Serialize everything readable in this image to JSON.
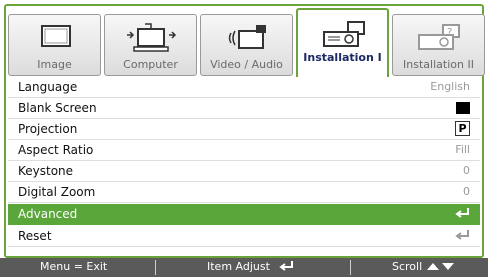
{
  "tabs": [
    {
      "label": "Image",
      "icon": "image-monitor-icon",
      "active": false
    },
    {
      "label": "Computer",
      "icon": "computer-icon",
      "active": false
    },
    {
      "label": "Video / Audio",
      "icon": "video-audio-icon",
      "active": false
    },
    {
      "label": "Installation I",
      "icon": "projector-icon",
      "active": true
    },
    {
      "label": "Installation II",
      "icon": "projector-settings-icon",
      "active": false
    }
  ],
  "menu": [
    {
      "label": "Language",
      "value": "English"
    },
    {
      "label": "Blank Screen",
      "value_icon": "black-square-icon"
    },
    {
      "label": "Projection",
      "value_icon": "projection-p-icon",
      "value_text": "P"
    },
    {
      "label": "Aspect Ratio",
      "value": "Fill"
    },
    {
      "label": "Keystone",
      "value": "0"
    },
    {
      "label": "Digital Zoom",
      "value": "0"
    },
    {
      "label": "Advanced",
      "value_icon": "enter-icon",
      "selected": true
    },
    {
      "label": "Reset",
      "value_icon": "enter-icon"
    }
  ],
  "footer": {
    "menu_exit": "Menu = Exit",
    "item_adjust": "Item Adjust",
    "scroll": "Scroll"
  },
  "colors": {
    "accent": "#5aa63a",
    "active_tab_text": "#1b2a63",
    "footer_bg": "#5a5a5a"
  }
}
